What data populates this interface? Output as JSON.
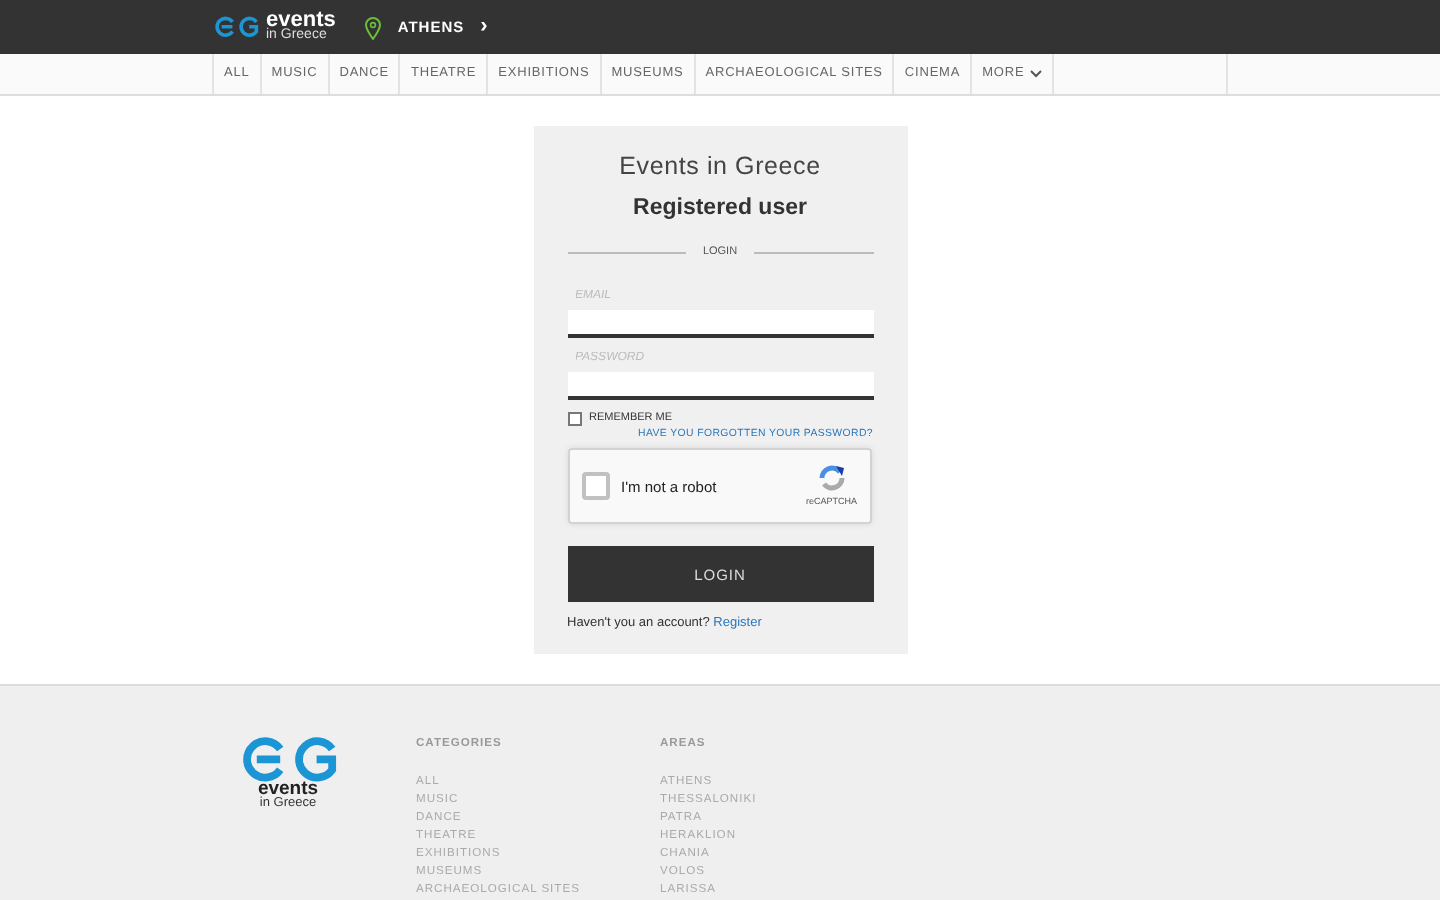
{
  "header": {
    "logo": {
      "line_1": "events",
      "line_2": "in Greece"
    },
    "location": "ATHENS",
    "location_caret": "›"
  },
  "categories": [
    {
      "label": "ALL"
    },
    {
      "label": "MUSIC"
    },
    {
      "label": "DANCE"
    },
    {
      "label": "THEATRE"
    },
    {
      "label": "EXHIBITIONS"
    },
    {
      "label": "MUSEUMS"
    },
    {
      "label": "ARCHAEOLOGICAL SITES"
    },
    {
      "label": "CINEMA"
    },
    {
      "label": "MORE",
      "kind": "dropdown"
    }
  ],
  "login": {
    "site": "Events in Greece",
    "title": "Registered user",
    "section": "LOGIN",
    "fields": [
      {
        "placeholder": "EMAIL"
      },
      {
        "placeholder": "PASSWORD"
      }
    ],
    "remember": {
      "label": "REMEMBER ME",
      "checked": false
    },
    "forgot": "HAVE YOU FORGOTTEN YOUR PASSWORD?",
    "captcha": {
      "label": "I'm not a robot",
      "checked": false,
      "brand": "reCAPTCHA"
    },
    "button": "LOGIN",
    "signup_text": "Haven't you an account?",
    "signup_link": "Register"
  },
  "footer": {
    "logo": {
      "line_1": "events",
      "line_2": "in Greece"
    },
    "columns": [
      {
        "heading": "CATEGORIES",
        "links": [
          "ALL",
          "MUSIC",
          "DANCE",
          "THEATRE",
          "EXHIBITIONS",
          "MUSEUMS",
          "ARCHAEOLOGICAL SITES"
        ]
      },
      {
        "heading": "AREAS",
        "links": [
          "ATHENS",
          "THESSALONIKI",
          "PATRA",
          "HERAKLION",
          "CHANIA",
          "VOLOS",
          "LARISSA"
        ]
      }
    ]
  }
}
